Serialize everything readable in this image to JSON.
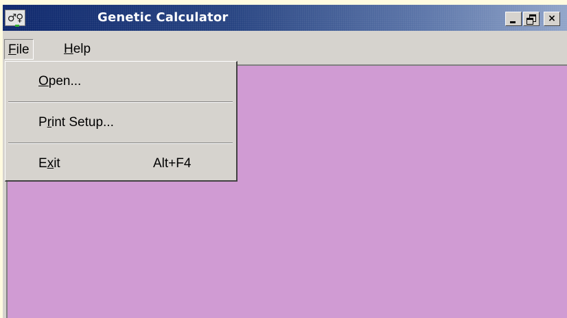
{
  "window": {
    "title": "Genetic Calculator",
    "app_icon_text": "♂♀",
    "buttons": {
      "minimize_icon": "minimize-icon",
      "restore_icon": "restore-icon",
      "close_label": "×"
    }
  },
  "menubar": {
    "file": {
      "hotkey": "F",
      "rest": "ile"
    },
    "help": {
      "hotkey": "H",
      "rest": "elp"
    }
  },
  "file_menu": {
    "items": [
      {
        "pre": "",
        "hotkey": "O",
        "post": "pen...",
        "shortcut": ""
      },
      {
        "pre": "P",
        "hotkey": "r",
        "post": "int Setup...",
        "shortcut": ""
      },
      {
        "pre": "E",
        "hotkey": "x",
        "post": "it",
        "shortcut": "Alt+F4"
      }
    ]
  },
  "colors": {
    "titlebar_start": "#0a246a",
    "titlebar_end": "#8fa3c8",
    "face": "#d6d3ce",
    "client_background": "#d09bd3",
    "page_background": "#fffbe0"
  }
}
